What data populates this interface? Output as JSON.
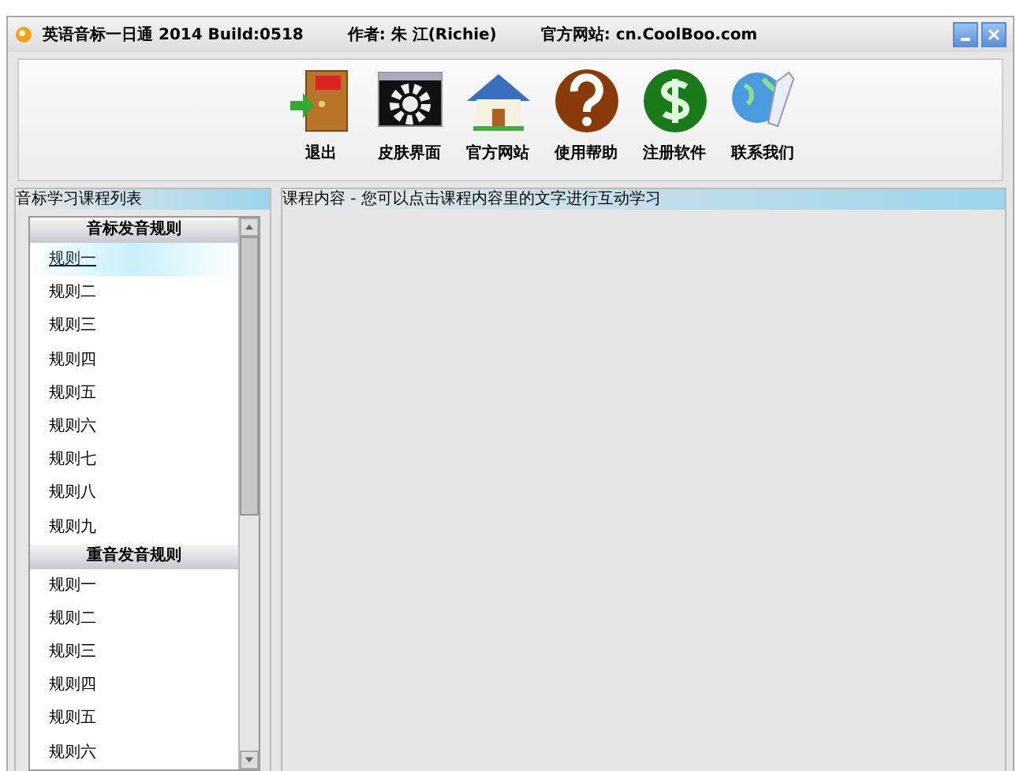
{
  "window": {
    "title": "英语音标一日通 2014 Build:0518",
    "author": "作者: 朱 江(Richie)",
    "website": "官方网站: cn.CoolBoo.com"
  },
  "toolbar": [
    {
      "kind": "exit",
      "label": "退出"
    },
    {
      "kind": "skin",
      "label": "皮肤界面"
    },
    {
      "kind": "home",
      "label": "官方网站"
    },
    {
      "kind": "help",
      "label": "使用帮助"
    },
    {
      "kind": "register",
      "label": "注册软件"
    },
    {
      "kind": "contact",
      "label": "联系我们"
    }
  ],
  "sidebar": {
    "title": "音标学习课程列表",
    "groups": [
      {
        "title": "音标发音规则",
        "items": [
          {
            "label": "规则一",
            "selected": true
          },
          {
            "label": "规则二",
            "selected": false
          },
          {
            "label": "规则三",
            "selected": false
          },
          {
            "label": "规则四",
            "selected": false
          },
          {
            "label": "规则五",
            "selected": false
          },
          {
            "label": "规则六",
            "selected": false
          },
          {
            "label": "规则七",
            "selected": false
          },
          {
            "label": "规则八",
            "selected": false
          },
          {
            "label": "规则九",
            "selected": false
          }
        ]
      },
      {
        "title": "重音发音规则",
        "items": [
          {
            "label": "规则一",
            "selected": false
          },
          {
            "label": "规则二",
            "selected": false
          },
          {
            "label": "规则三",
            "selected": false
          },
          {
            "label": "规则四",
            "selected": false
          },
          {
            "label": "规则五",
            "selected": false
          },
          {
            "label": "规则六",
            "selected": false
          }
        ]
      }
    ]
  },
  "content": {
    "title": "课程内容 - 您可以点击课程内容里的文字进行互动学习"
  }
}
